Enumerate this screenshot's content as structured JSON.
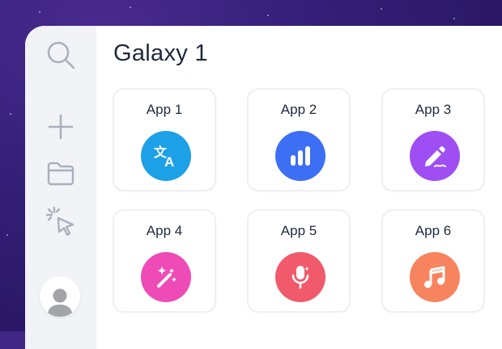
{
  "page": {
    "title": "Galaxy 1"
  },
  "sidebar": {
    "icons": [
      {
        "name": "search-icon"
      },
      {
        "name": "plus-icon"
      },
      {
        "name": "folder-icon"
      },
      {
        "name": "cursor-click-icon"
      }
    ],
    "avatar": {
      "name": "user-avatar-icon"
    }
  },
  "apps": [
    {
      "label": "App 1",
      "icon": "translate-icon",
      "color": "#1da1e6"
    },
    {
      "label": "App 2",
      "icon": "bar-chart-icon",
      "color": "#3d6ff4"
    },
    {
      "label": "App 3",
      "icon": "pen-icon",
      "color": "#9f4ef3"
    },
    {
      "label": "App 4",
      "icon": "magic-wand-icon",
      "color": "#ee4bb6"
    },
    {
      "label": "App 5",
      "icon": "microphone-icon",
      "color": "#f15a6b"
    },
    {
      "label": "App 6",
      "icon": "music-note-icon",
      "color": "#f7845e"
    }
  ]
}
